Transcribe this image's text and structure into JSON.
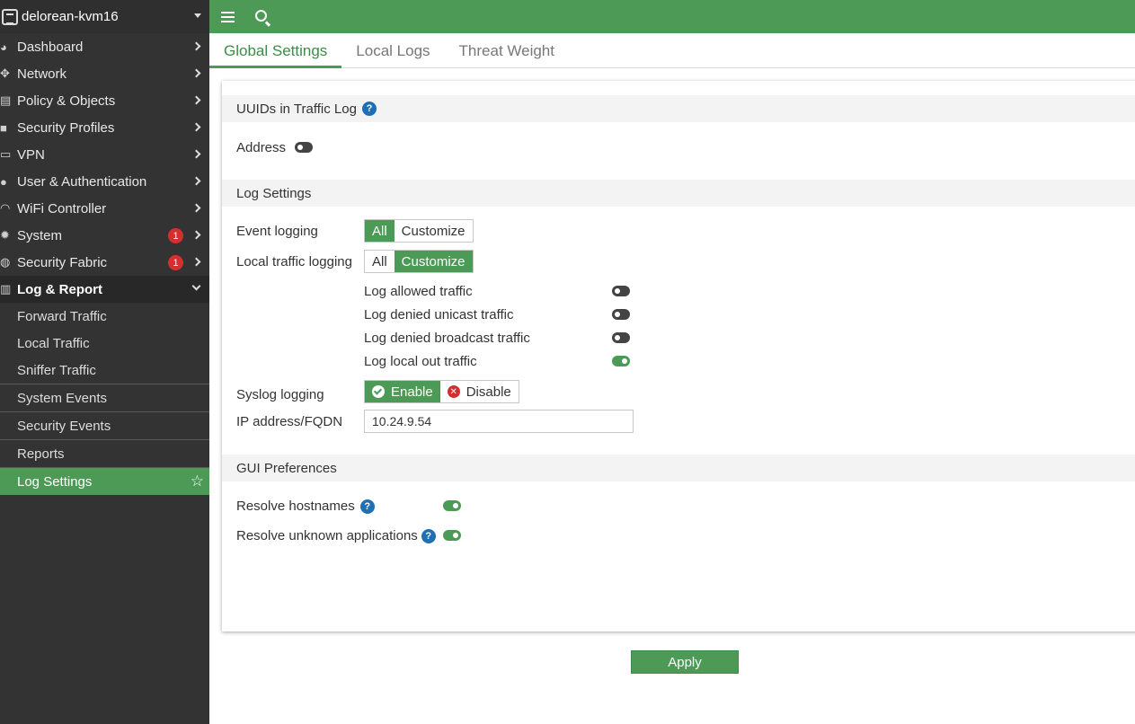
{
  "device": {
    "name": "delorean-kvm16"
  },
  "nav": {
    "items": [
      {
        "label": "Dashboard",
        "icon": "dashboard-icon"
      },
      {
        "label": "Network",
        "icon": "network-icon"
      },
      {
        "label": "Policy & Objects",
        "icon": "policy-icon"
      },
      {
        "label": "Security Profiles",
        "icon": "lock-icon"
      },
      {
        "label": "VPN",
        "icon": "laptop-icon"
      },
      {
        "label": "User & Authentication",
        "icon": "user-icon"
      },
      {
        "label": "WiFi Controller",
        "icon": "wifi-icon"
      },
      {
        "label": "System",
        "icon": "gear-icon",
        "badge": "1"
      },
      {
        "label": "Security Fabric",
        "icon": "fabric-icon",
        "badge": "1"
      },
      {
        "label": "Log & Report",
        "icon": "chart-icon"
      }
    ],
    "sub_items": [
      {
        "label": "Forward Traffic"
      },
      {
        "label": "Local Traffic"
      },
      {
        "label": "Sniffer Traffic"
      },
      {
        "label": "System Events"
      },
      {
        "label": "Security Events"
      },
      {
        "label": "Reports"
      },
      {
        "label": "Log Settings"
      }
    ]
  },
  "tabs": [
    {
      "label": "Global Settings"
    },
    {
      "label": "Local Logs"
    },
    {
      "label": "Threat Weight"
    }
  ],
  "uuid_section": {
    "title": "UUIDs in Traffic Log",
    "address_label": "Address",
    "address_enabled": false
  },
  "log_settings": {
    "title": "Log Settings",
    "event_logging": {
      "label": "Event logging",
      "options": [
        "All",
        "Customize"
      ],
      "selected": "All"
    },
    "local_traffic_logging": {
      "label": "Local traffic logging",
      "options": [
        "All",
        "Customize"
      ],
      "selected": "Customize"
    },
    "local_options": [
      {
        "label": "Log allowed traffic",
        "enabled": false
      },
      {
        "label": "Log denied unicast traffic",
        "enabled": false
      },
      {
        "label": "Log denied broadcast traffic",
        "enabled": false
      },
      {
        "label": "Log local out traffic",
        "enabled": true
      }
    ],
    "syslog": {
      "label": "Syslog logging",
      "enable_label": "Enable",
      "disable_label": "Disable",
      "selected": "Enable"
    },
    "ip": {
      "label": "IP address/FQDN",
      "value": "10.24.9.54"
    }
  },
  "gui_prefs": {
    "title": "GUI Preferences",
    "resolve_hostnames": {
      "label": "Resolve hostnames",
      "enabled": true
    },
    "resolve_apps": {
      "label": "Resolve unknown applications",
      "enabled": true
    }
  },
  "apply_label": "Apply",
  "colors": {
    "accent": "#4c9a55",
    "sidebar": "#333333",
    "badge": "#d32f2f",
    "help": "#1f6fb2"
  }
}
